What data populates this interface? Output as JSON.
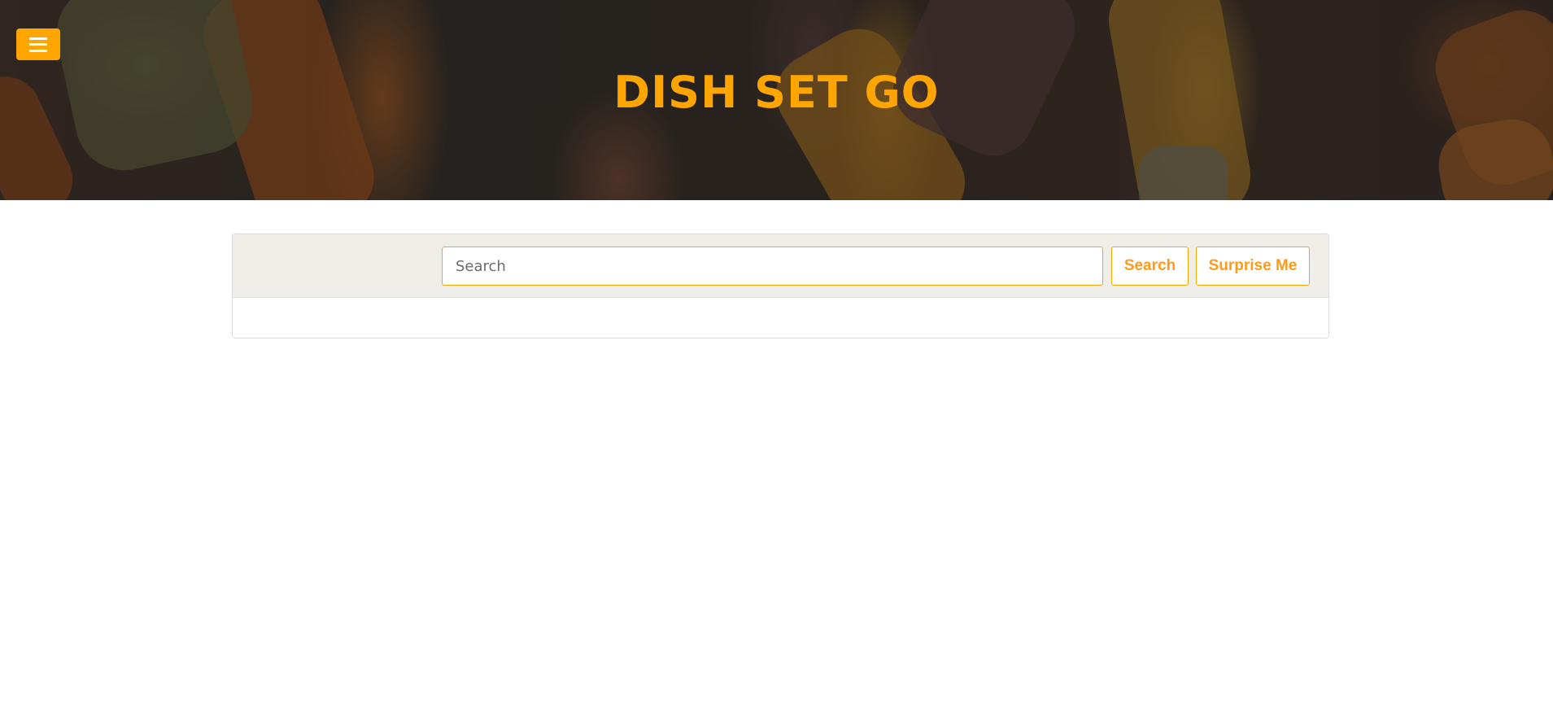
{
  "header": {
    "title": "DISH SET GO",
    "menu_icon": "hamburger-menu-icon"
  },
  "search": {
    "placeholder": "Search",
    "value": "",
    "search_label": "Search",
    "surprise_label": "Surprise Me"
  },
  "colors": {
    "accent": "#ffa500",
    "panel_header_bg": "#f0eee9",
    "border": "#dcdcdc"
  }
}
